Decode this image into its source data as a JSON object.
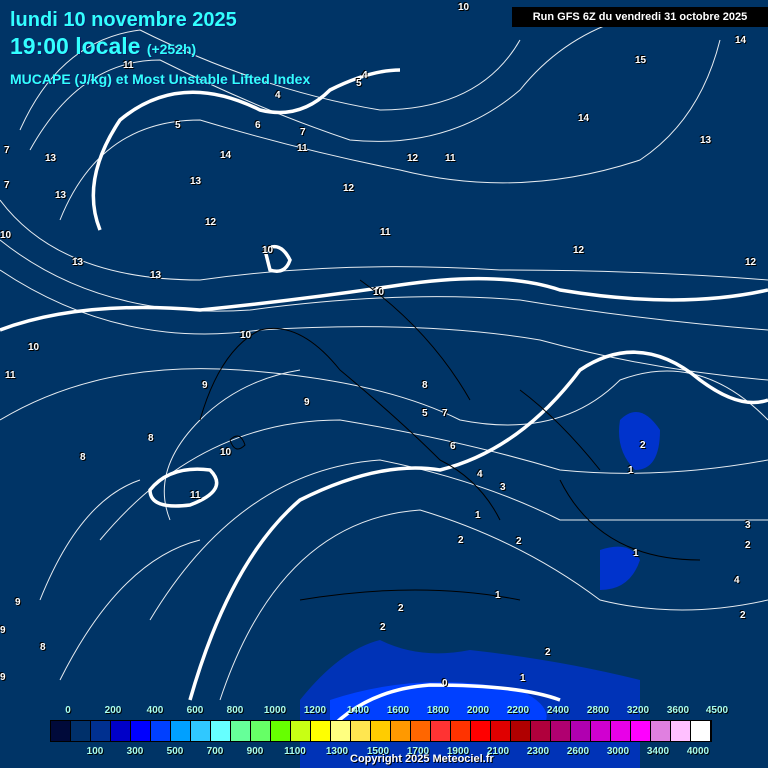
{
  "header": {
    "date": "lundi 10 novembre 2025",
    "time": "19:00 locale",
    "lead": "(+252h)",
    "parameter": "MUCAPE (J/kg) et Most Unstable Lifted Index"
  },
  "run_info": "Run GFS 6Z du vendredi 31 octobre 2025",
  "copyright": "Copyright 2025 Meteociel.fr",
  "colorbar": {
    "top_labels": [
      "0",
      "200",
      "400",
      "600",
      "800",
      "1000",
      "1200",
      "1400",
      "1600",
      "1800",
      "2000",
      "2200",
      "2400",
      "2800",
      "3200",
      "3600",
      "4500"
    ],
    "bottom_labels": [
      "100",
      "300",
      "500",
      "700",
      "900",
      "1100",
      "1300",
      "1500",
      "1700",
      "1900",
      "2100",
      "2300",
      "2600",
      "3000",
      "3400",
      "4000"
    ],
    "colors": [
      "#000a3a",
      "#00306a",
      "#003090",
      "#0000c8",
      "#0000ff",
      "#0040ff",
      "#00a0ff",
      "#30c8ff",
      "#66ffff",
      "#66ff99",
      "#66ff66",
      "#66ff00",
      "#c8ff14",
      "#ffff00",
      "#ffff80",
      "#ffe650",
      "#ffcc00",
      "#ff9900",
      "#ff6600",
      "#ff3333",
      "#ff3300",
      "#ff0000",
      "#e00000",
      "#b00000",
      "#b0003c",
      "#b00070",
      "#b000b0",
      "#d000d0",
      "#e800e8",
      "#ff00ff",
      "#e080e0",
      "#ffc0ff",
      "#ffffff"
    ]
  },
  "contour_labels": [
    "10",
    "14",
    "15",
    "4",
    "5",
    "4",
    "5",
    "6",
    "7",
    "11",
    "11",
    "14",
    "13",
    "12",
    "11",
    "13",
    "13",
    "12",
    "12",
    "11",
    "12",
    "12",
    "10",
    "13",
    "13",
    "10",
    "10",
    "9",
    "8",
    "8",
    "9",
    "10",
    "11",
    "11",
    "10",
    "8",
    "5",
    "7",
    "6",
    "4",
    "3",
    "2",
    "1",
    "2",
    "2",
    "1",
    "2",
    "2",
    "1",
    "2",
    "0",
    "1",
    "1",
    "2",
    "9",
    "8",
    "9",
    "9",
    "14",
    "13",
    "7",
    "7",
    "10",
    "2",
    "3",
    "4"
  ]
}
